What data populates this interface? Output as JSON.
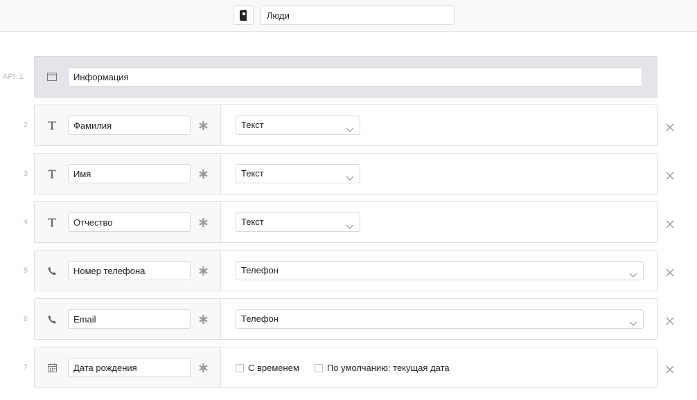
{
  "header": {
    "collection_icon": "book-icon",
    "collection_name": "Люди"
  },
  "info_row": {
    "number": "API: 1",
    "icon": "window-icon",
    "name": "Информация"
  },
  "fields": [
    {
      "number": "2",
      "icon": "text-type-icon",
      "name": "Фамилия",
      "type": "Текст"
    },
    {
      "number": "3",
      "icon": "text-type-icon",
      "name": "Имя",
      "type": "Текст"
    },
    {
      "number": "4",
      "icon": "text-type-icon",
      "name": "Отчество",
      "type": "Текст"
    },
    {
      "number": "5",
      "icon": "phone-icon",
      "name": "Номер телефона",
      "type": "Телефон"
    },
    {
      "number": "6",
      "icon": "phone-icon",
      "name": "Email",
      "type": "Телефон"
    },
    {
      "number": "7",
      "icon": "calendar-icon",
      "name": "Дата рождения",
      "options": [
        "С временем",
        "По умолчанию: текущая дата"
      ]
    }
  ]
}
